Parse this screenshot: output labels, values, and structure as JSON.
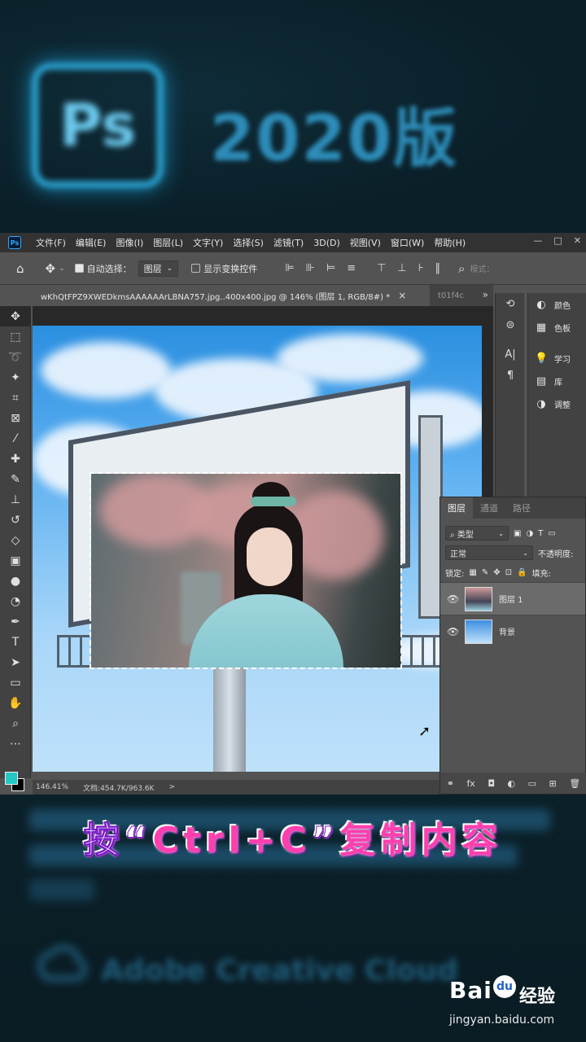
{
  "promo": {
    "logo_text": "Ps",
    "version": "2020版",
    "cc_text": "Adobe Creative Cloud"
  },
  "menubar": {
    "logo": "Ps",
    "items": [
      "文件(F)",
      "编辑(E)",
      "图像(I)",
      "图层(L)",
      "文字(Y)",
      "选择(S)",
      "滤镜(T)",
      "3D(D)",
      "视图(V)",
      "窗口(W)",
      "帮助(H)"
    ],
    "controls": [
      "—",
      "□",
      "✕"
    ]
  },
  "options": {
    "auto_select_label": "自动选择：",
    "auto_select_value": "图层",
    "show_transform_label": "显示变换控件",
    "mode_label": "模式："
  },
  "tabs": {
    "active": "wKhQtFPZ9XWEDkmsAAAAAArLBNA757.jpg..400x400.jpg @ 146% (图层 1, RGB/8#) *",
    "close": "×",
    "inactive": "t01f4c",
    "more": "»"
  },
  "statusbar": {
    "zoom": "146.41%",
    "doc": "文档:454.7K/963.6K",
    "arrow": ">"
  },
  "dock": {
    "items": [
      {
        "icon": "◐",
        "label": "颜色"
      },
      {
        "icon": "▦",
        "label": "色板"
      },
      {
        "icon": "💡",
        "label": "学习"
      },
      {
        "icon": "▤",
        "label": "库"
      },
      {
        "icon": "◑",
        "label": "调整"
      }
    ]
  },
  "layers": {
    "tabs": [
      "图层",
      "通道",
      "路径"
    ],
    "filter_label": "类型",
    "blend_mode": "正常",
    "opacity_label": "不透明度:",
    "lock_label": "锁定:",
    "fill_label": "填充:",
    "items": [
      {
        "name": "图层 1",
        "selected": true
      },
      {
        "name": "背景",
        "selected": false
      }
    ],
    "footer_icons": [
      "⚭",
      "fx",
      "◘",
      "◐",
      "▭",
      "⊞",
      "🗑"
    ]
  },
  "caption": {
    "prefix": "按",
    "quote_open": "“",
    "keys": "Ctrl+C",
    "quote_close": "”",
    "suffix": "复制内容"
  },
  "watermark": {
    "brand_en": "Bai",
    "paw": "du",
    "brand_cn": "经验",
    "url": "jingyan.baidu.com"
  },
  "colors": {
    "foreground": "#25c7c4",
    "background": "#000000",
    "caption": "#ff3fae",
    "ps_blue": "#31a8ff"
  }
}
